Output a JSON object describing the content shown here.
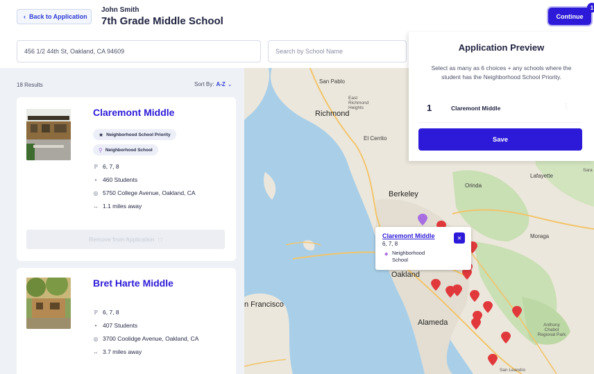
{
  "header": {
    "back_label": "Back to Application",
    "student_name": "John Smith",
    "grade_title": "7th Grade Middle School",
    "continue_label": "Continue",
    "continue_badge": "1"
  },
  "search": {
    "address_value": "456 1/2 44th St, Oakland, CA 94609",
    "school_placeholder": "Search by School Name"
  },
  "list": {
    "results_count": "18 Results",
    "sort_label": "Sort By:",
    "sort_value": "A-Z",
    "schools": [
      {
        "name": "Claremont Middle",
        "tags": [
          "Neighborhood School Priority",
          "Neighborhood School"
        ],
        "grades": "6, 7, 8",
        "students": "460 Students",
        "address": "5750 College Avenue, Oakland, CA",
        "distance": "1.1 miles away",
        "action_label": "Remove from Application"
      },
      {
        "name": "Bret Harte Middle",
        "grades": "6, 7, 8",
        "students": "407 Students",
        "address": "3700 Coolidge Avenue, Oakland, CA",
        "distance": "3.7 miles away"
      }
    ]
  },
  "map": {
    "labels": {
      "san_pablo": "San Pablo",
      "east_richmond": "East Richmond Heights",
      "richmond": "Richmond",
      "el_cerrito": "El Cerrito",
      "berkeley": "Berkeley",
      "orinda": "Orinda",
      "lafayette": "Lafayette",
      "moraga": "Moraga",
      "oakland": "Oakland",
      "alameda": "Alameda",
      "san_francisco": "n Francisco",
      "anthony_chabot": "Anthony Chabot Regional Park",
      "sara": "Sara",
      "san_leandro": "San Leandro"
    },
    "colors": {
      "pin_red": "#e0383b",
      "pin_purple": "#a86de0",
      "water": "#a9cfe8",
      "land": "#ece7dc",
      "park": "#c9dfb4"
    },
    "popup": {
      "title": "Claremont Middle",
      "grades": "6, 7, 8",
      "tag": "Neighborhood School",
      "close_icon": "close-icon"
    }
  },
  "preview": {
    "title": "Application Preview",
    "description": "Select as many as 6 choices + any schools where the student has the Neighborhood School Priority.",
    "choices": [
      {
        "rank": "1",
        "name": "Claremont Middle"
      }
    ],
    "save_label": "Save"
  },
  "accent": "#2c1ad8"
}
